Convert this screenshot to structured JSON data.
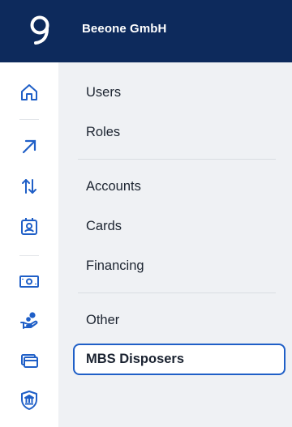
{
  "header": {
    "company_name": "Beeone GmbH",
    "logo_icon": "logo-icon"
  },
  "rail": {
    "items": [
      {
        "icon": "home-icon",
        "label": "Home"
      },
      {
        "icon": "arrow-up-right-icon",
        "label": "Payments"
      },
      {
        "icon": "transfer-arrows-icon",
        "label": "Transfers"
      },
      {
        "icon": "badge-icon",
        "label": "Identity"
      },
      {
        "icon": "cash-icon",
        "label": "Cash"
      },
      {
        "icon": "hand-coin-icon",
        "label": "Financing"
      },
      {
        "icon": "cards-icon",
        "label": "Cards"
      },
      {
        "icon": "bank-shield-icon",
        "label": "Bank"
      }
    ]
  },
  "menu": {
    "items": [
      "Users",
      "Roles",
      "Accounts",
      "Cards",
      "Financing",
      "Other",
      "MBS Disposers"
    ],
    "active": "MBS Disposers"
  },
  "colors": {
    "header_bg": "#0d2a5c",
    "icon_blue": "#1f5fc7",
    "panel_bg": "#eff1f4",
    "active_border": "#1f5fc7"
  }
}
